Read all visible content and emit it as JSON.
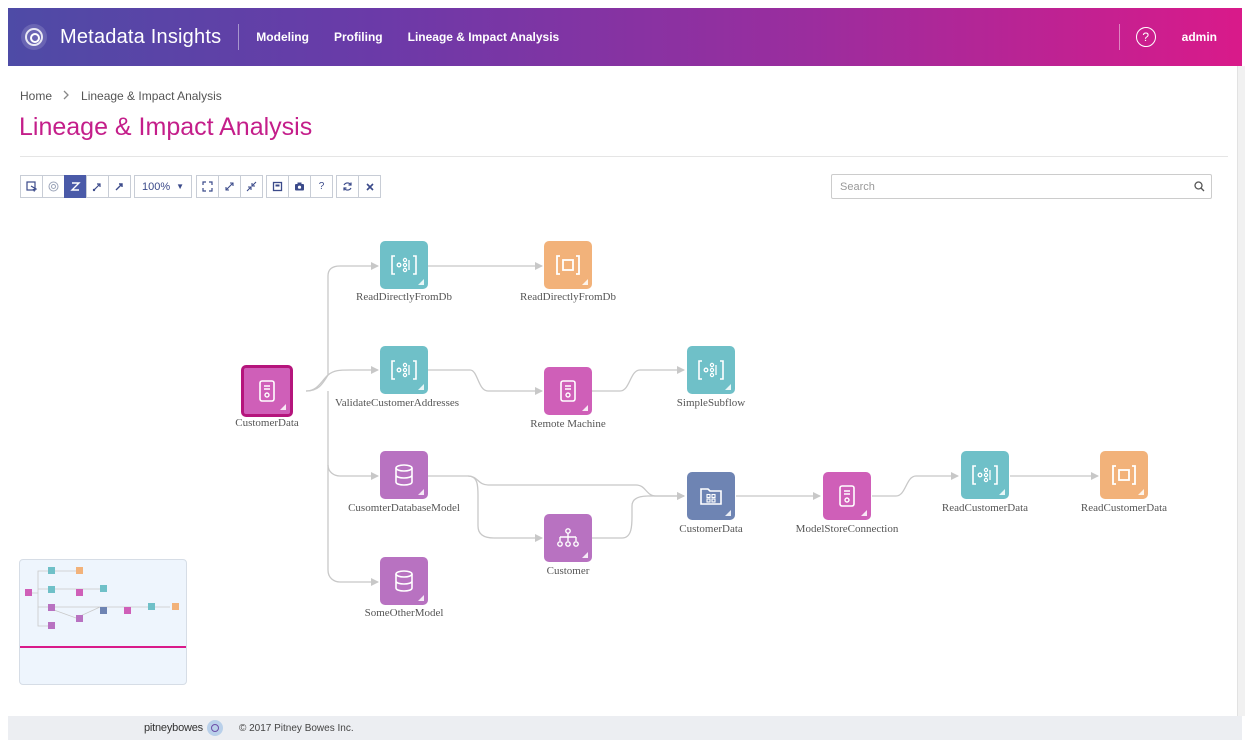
{
  "header": {
    "app_title": "Metadata Insights",
    "nav": [
      "Modeling",
      "Profiling",
      "Lineage & Impact Analysis"
    ],
    "help_glyph": "?",
    "user": "admin"
  },
  "breadcrumb": {
    "home": "Home",
    "current": "Lineage & Impact Analysis"
  },
  "page_title": "Lineage & Impact Analysis",
  "toolbar": {
    "zoom_level": "100%",
    "help_glyph": "?",
    "buttons": [
      "select-icon",
      "target-icon",
      "lineage-icon",
      "expand-upstream-icon",
      "expand-downstream-icon",
      "fit-icon",
      "expand-icon",
      "collapse-icon",
      "save-icon",
      "camera-icon",
      "help-icon",
      "refresh-icon",
      "close-icon"
    ]
  },
  "search": {
    "placeholder": "Search"
  },
  "graph": {
    "nodes": [
      {
        "label": "CustomerData",
        "type": "connection",
        "color": "#cf5fb8",
        "selected": true
      },
      {
        "label": "ReadDirectlyFromDb",
        "type": "subflow",
        "color": "#6fc0c8"
      },
      {
        "label": "ReadDirectlyFromDb",
        "type": "endpoint",
        "color": "#f2b27a"
      },
      {
        "label": "ValidateCustomerAddresses",
        "type": "subflow",
        "color": "#6fc0c8"
      },
      {
        "label": "Remote Machine",
        "type": "connection",
        "color": "#cf5fb8"
      },
      {
        "label": "SimpleSubflow",
        "type": "subflow",
        "color": "#6fc0c8"
      },
      {
        "label": "CusomterDatabaseModel",
        "type": "database",
        "color": "#b872c1"
      },
      {
        "label": "Customer",
        "type": "hierarchy",
        "color": "#b872c1"
      },
      {
        "label": "CustomerData",
        "type": "folder",
        "color": "#6e84b3"
      },
      {
        "label": "ModelStoreConnection",
        "type": "connection",
        "color": "#cf5fb8"
      },
      {
        "label": "ReadCustomerData",
        "type": "subflow",
        "color": "#6fc0c8"
      },
      {
        "label": "ReadCustomerData",
        "type": "endpoint",
        "color": "#f2b27a"
      },
      {
        "label": "SomeOtherModel",
        "type": "database",
        "color": "#b872c1"
      }
    ]
  },
  "footer": {
    "brand": "pitneybowes",
    "copyright": "© 2017 Pitney Bowes Inc."
  },
  "colors": {
    "accent": "#c41e8a",
    "toolbar_active": "#4a5aa8",
    "edge": "#c8c8c8"
  }
}
